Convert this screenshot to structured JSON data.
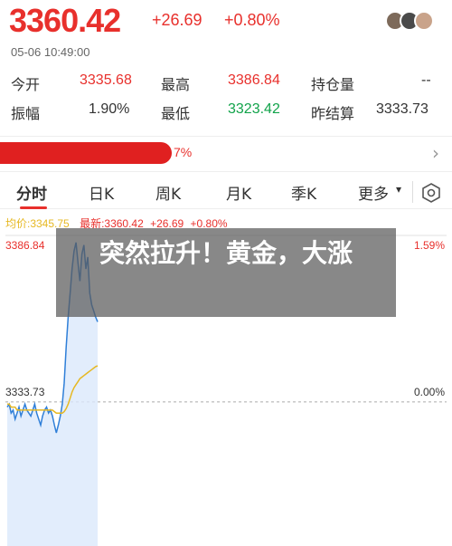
{
  "header": {
    "price": "3360.42",
    "change": "+26.69",
    "change_pct": "+0.80%",
    "timestamp": "05-06 10:49:00"
  },
  "stats": {
    "row1": {
      "label1": "今开",
      "value1": "3335.68",
      "label2": "最高",
      "value2": "3386.84",
      "label3": "持仓量",
      "value3": "--"
    },
    "row2": {
      "label1": "振幅",
      "value1": "1.90%",
      "label2": "最低",
      "value2": "3323.42",
      "label3": "昨结算",
      "value3": "3333.73"
    }
  },
  "banner": {
    "pct": "7%"
  },
  "tabs": [
    {
      "label": "分时"
    },
    {
      "label": "日K"
    },
    {
      "label": "周K"
    },
    {
      "label": "月K"
    },
    {
      "label": "季K"
    },
    {
      "label": "更多"
    }
  ],
  "chart_legend": {
    "avg": "均价:3345.75",
    "latest": "最新:3360.42",
    "change": "+26.69",
    "change_pct": "+0.80%"
  },
  "overlay_text": "突然拉升！黄金，大涨",
  "colors": {
    "up": "#e8302c",
    "down": "#11a34a",
    "price_line": "#2f7fd8",
    "avg_line": "#e6b822"
  },
  "chart_data": {
    "type": "line",
    "y_labels_left": [
      "3386.84",
      "3333.73"
    ],
    "y_labels_right": [
      "1.59%",
      "0.00%"
    ],
    "ylim": [
      3318,
      3388
    ],
    "prev_settle": 3333.73,
    "series": [
      {
        "values": [
          3332,
          3333,
          3330,
          3331,
          3328,
          3330,
          3332,
          3329,
          3331,
          3333,
          3331,
          3330,
          3329,
          3331,
          3333,
          3330,
          3328,
          3326,
          3329,
          3331,
          3332,
          3330,
          3331,
          3329,
          3326,
          3323.42,
          3326,
          3329,
          3333,
          3340,
          3352,
          3362,
          3370,
          3378,
          3384,
          3386.84,
          3380,
          3374,
          3383,
          3386,
          3378,
          3382,
          3370,
          3366,
          3364,
          3362,
          3360.42
        ]
      },
      {
        "values": [
          3333,
          3333,
          3332,
          3332,
          3332,
          3331,
          3331,
          3331,
          3331,
          3331,
          3331,
          3331,
          3331,
          3331,
          3331,
          3331,
          3331,
          3331,
          3331,
          3331,
          3331,
          3331,
          3331,
          3331,
          3330.5,
          3330,
          3330,
          3330,
          3330,
          3330.5,
          3331.5,
          3333,
          3335,
          3337,
          3338.5,
          3339.5,
          3340.5,
          3341.5,
          3342,
          3342.5,
          3343,
          3343.5,
          3344,
          3344.5,
          3345,
          3345.5,
          3345.75
        ]
      }
    ]
  }
}
